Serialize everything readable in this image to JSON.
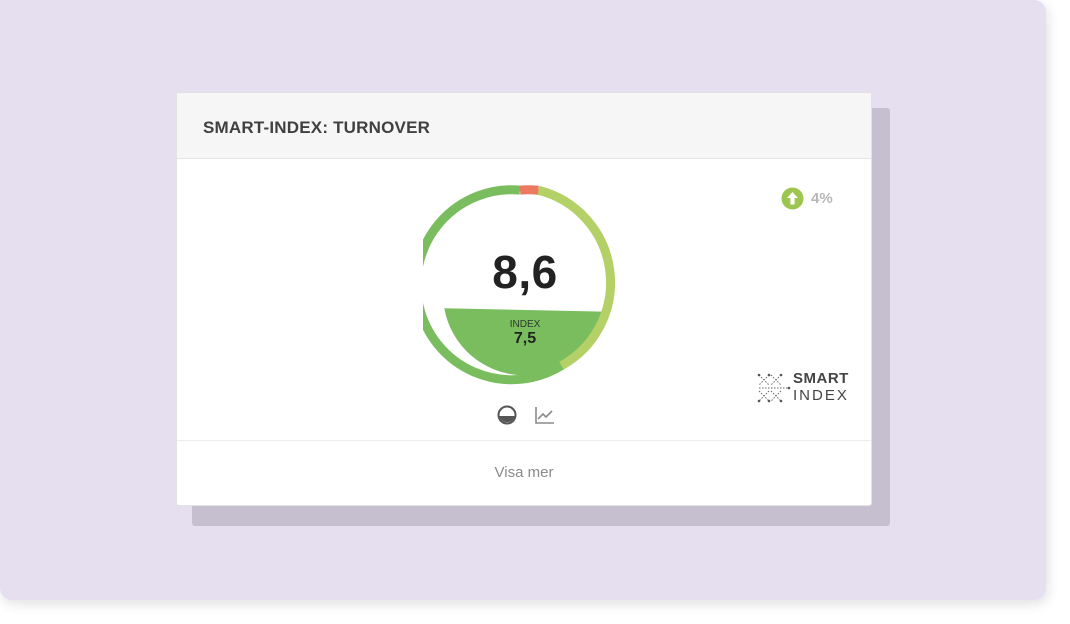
{
  "card": {
    "title": "SMART-INDEX: TURNOVER",
    "footer_link": "Visa mer"
  },
  "gauge": {
    "value": "8,6",
    "index_label": "INDEX",
    "index_value": "7,5",
    "colors": {
      "dark_green": "#7abd5e",
      "light_green": "#b3d166",
      "red": "#ec7a60",
      "fill": "#7abd5e"
    }
  },
  "trend": {
    "direction": "up",
    "value": "4%",
    "icon": "arrow-up-circle-icon",
    "color": "#9cc64f"
  },
  "logo": {
    "line1": "SMART",
    "line2": "INDEX"
  },
  "view_toggle": {
    "gauge_icon": "gauge-view-icon",
    "chart_icon": "line-chart-icon"
  }
}
